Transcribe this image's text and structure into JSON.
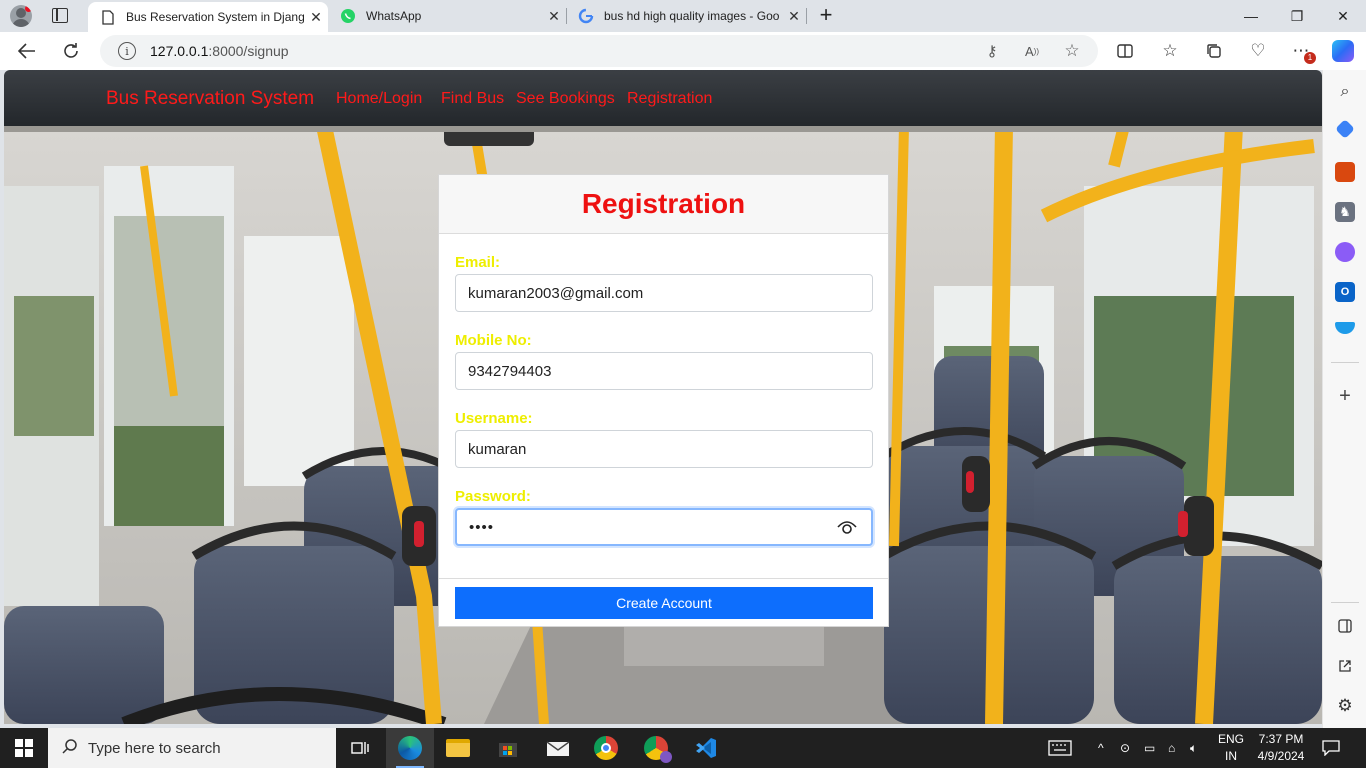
{
  "browser": {
    "tabs": [
      {
        "title": "Bus Reservation System in Djang",
        "active": true
      },
      {
        "title": "WhatsApp",
        "active": false
      },
      {
        "title": "bus hd high quality images - Goo",
        "active": false
      }
    ],
    "url_host": "127.0.0.1",
    "url_path": ":8000/signup",
    "notification_badge": "1"
  },
  "site": {
    "brand": "Bus Reservation System",
    "nav": [
      "Home/Login",
      "Find Bus",
      "See Bookings",
      "Registration"
    ]
  },
  "form": {
    "title": "Registration",
    "email_label": "Email:",
    "email_value": "kumaran2003@gmail.com",
    "mobile_label": "Mobile No:",
    "mobile_value": "9342794403",
    "username_label": "Username:",
    "username_value": "kumaran",
    "password_label": "Password:",
    "password_value": "••••",
    "submit_label": "Create Account"
  },
  "taskbar": {
    "search_placeholder": "Type here to search",
    "lang_top": "ENG",
    "lang_bottom": "IN",
    "time": "7:37 PM",
    "date": "4/9/2024"
  },
  "colors": {
    "accent_red": "#ff1a1a",
    "label_yellow": "#eeee00",
    "button_blue": "#0d6efd"
  }
}
